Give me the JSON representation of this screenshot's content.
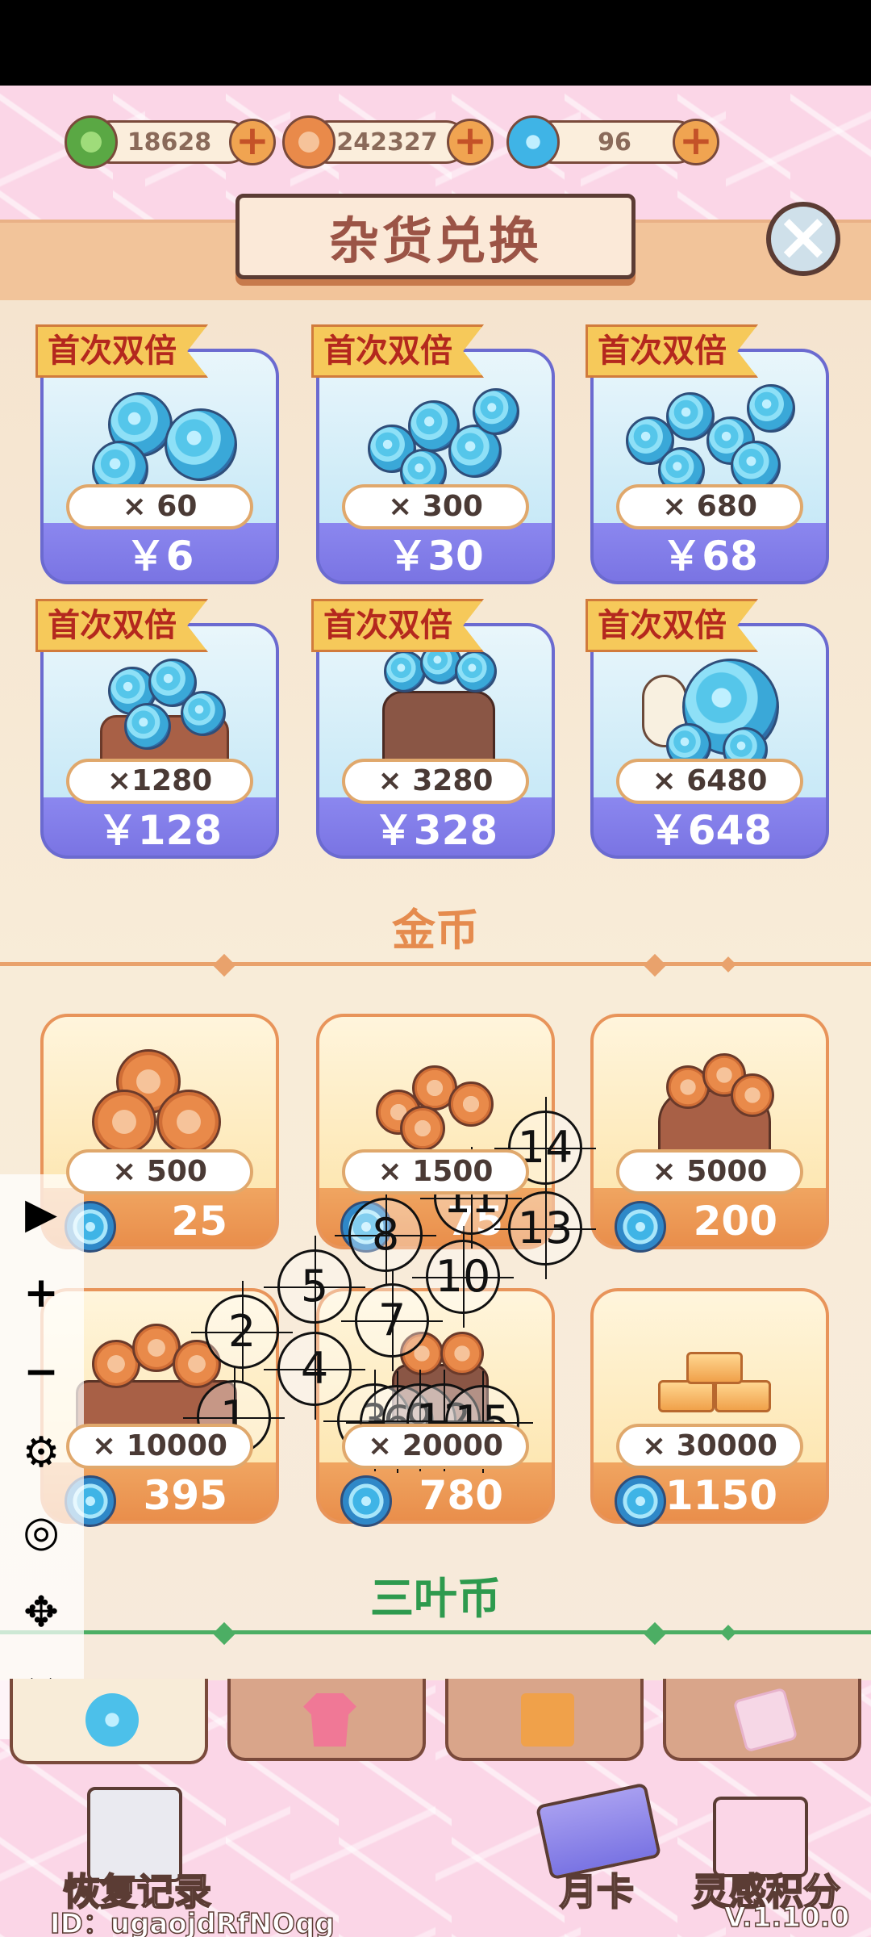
{
  "currencies": [
    {
      "name": "clover",
      "value": "18628",
      "color": "#6fbf5a"
    },
    {
      "name": "gold",
      "value": "242327",
      "color": "#e98a4a"
    },
    {
      "name": "orb",
      "value": "96",
      "color": "#3aa8d8"
    }
  ],
  "header": {
    "title": "杂货兑换"
  },
  "orb_packs": [
    {
      "ribbon": "首次双倍",
      "qty": "× 60",
      "price": "￥6"
    },
    {
      "ribbon": "首次双倍",
      "qty": "× 300",
      "price": "￥30"
    },
    {
      "ribbon": "首次双倍",
      "qty": "× 680",
      "price": "￥68"
    },
    {
      "ribbon": "首次双倍",
      "qty": "×1280",
      "price": "￥128"
    },
    {
      "ribbon": "首次双倍",
      "qty": "× 3280",
      "price": "￥328"
    },
    {
      "ribbon": "首次双倍",
      "qty": "× 6480",
      "price": "￥648"
    }
  ],
  "gold_section": {
    "title": "金币",
    "color": "#e58b4e"
  },
  "gold_packs": [
    {
      "qty": "× 500",
      "price": "25"
    },
    {
      "qty": "× 1500",
      "price": "75"
    },
    {
      "qty": "× 5000",
      "price": "200"
    },
    {
      "qty": "× 10000",
      "price": "395"
    },
    {
      "qty": "× 20000",
      "price": "780"
    },
    {
      "qty": "× 30000",
      "price": "1150"
    }
  ],
  "clover_section": {
    "title": "三叶币",
    "color": "#2e9a4e"
  },
  "float_toolbar": [
    {
      "icon": "play-icon",
      "glyph": "▶"
    },
    {
      "icon": "plus-icon",
      "glyph": "+"
    },
    {
      "icon": "minus-icon",
      "glyph": "−"
    },
    {
      "icon": "gear-icon",
      "glyph": "⚙"
    },
    {
      "icon": "eye-off-icon",
      "glyph": "◎"
    },
    {
      "icon": "move-icon",
      "glyph": "✥"
    },
    {
      "icon": "close-icon",
      "glyph": "✕"
    }
  ],
  "markers": [
    "1",
    "2",
    "3",
    "4",
    "5",
    "6",
    "7",
    "8",
    "9",
    "10",
    "11",
    "12",
    "13",
    "14",
    "15"
  ],
  "tabs": [
    {
      "icon": "orb-tab-icon"
    },
    {
      "icon": "shirt-tab-icon"
    },
    {
      "icon": "gift-tab-icon"
    },
    {
      "icon": "scroll-tab-icon"
    }
  ],
  "bottom": {
    "restore_label": "恢复记录",
    "monthly_label": "月卡",
    "inspiration_label": "灵感积分",
    "user_id": "ID：ugaojdRfNOqg",
    "version": "V.1.10.0"
  }
}
